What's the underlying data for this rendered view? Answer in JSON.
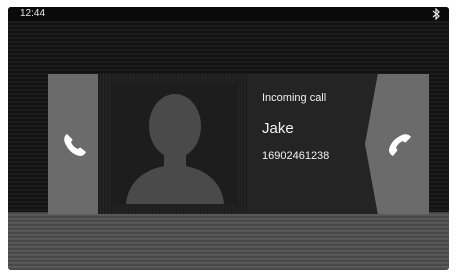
{
  "status_bar": {
    "time": "12:44",
    "icons": [
      "bluetooth-icon"
    ]
  },
  "call": {
    "title": "Incoming call",
    "caller_name": "Jake",
    "caller_number": "16902461238"
  },
  "actions": {
    "accept_icon": "phone-answer-icon",
    "decline_icon": "phone-hangup-icon"
  },
  "colors": {
    "background": "#151515",
    "side_panel": "#6b6b6b",
    "text": "#f2f2f2"
  }
}
